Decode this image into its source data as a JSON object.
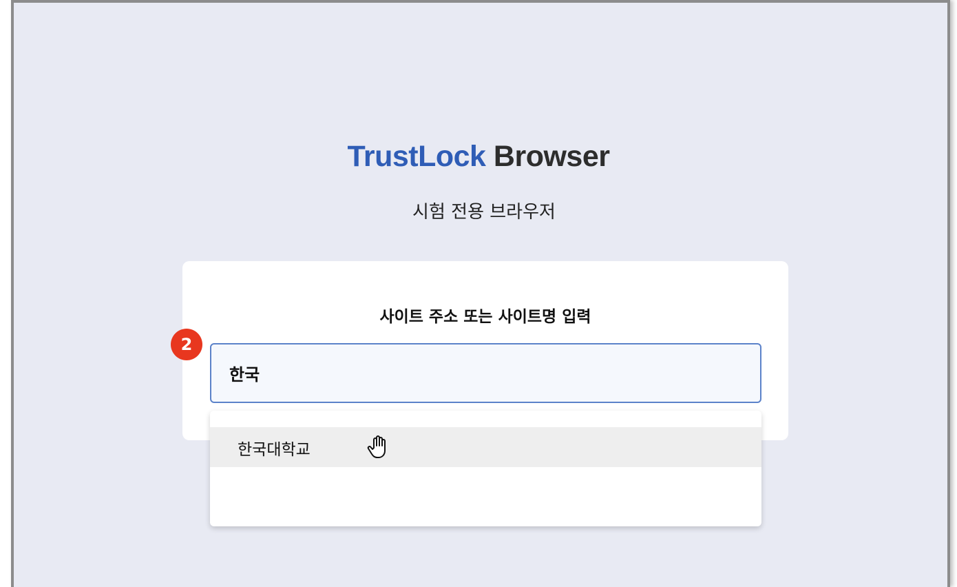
{
  "header": {
    "brand_accent": "TrustLock",
    "brand_rest": " Browser",
    "subtitle": "시험 전용 브라우저"
  },
  "card": {
    "title": "사이트 주소 또는 사이트명 입력"
  },
  "step_badge": "2",
  "url_input": {
    "value": "한국"
  },
  "dropdown": {
    "suggestions": [
      {
        "label": "한국대학교"
      }
    ]
  },
  "icons": {
    "cursor": "hand-pointer-icon"
  },
  "colors": {
    "accent": "#2f5db6",
    "background": "#e8eaf3",
    "badge": "#e8371f",
    "input_border": "#5b82c9",
    "highlight": "#eeeeee"
  }
}
